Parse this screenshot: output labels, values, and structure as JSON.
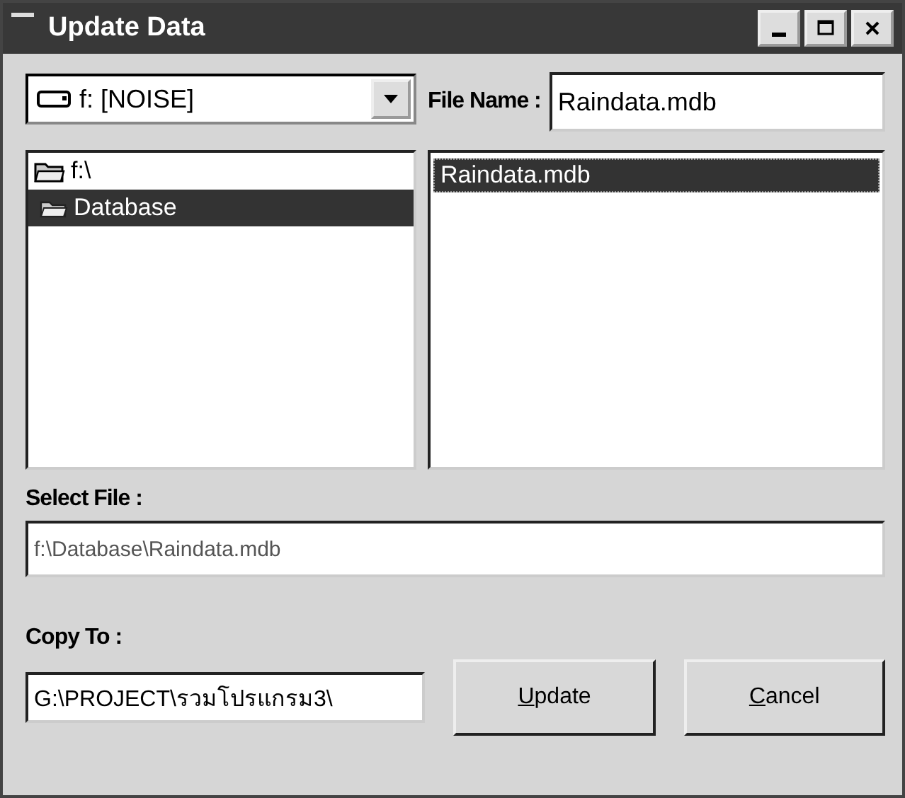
{
  "window": {
    "title": "Update Data"
  },
  "drive": {
    "value": "f: [NOISE]"
  },
  "file_name": {
    "label": "File Name :",
    "value": "Raindata.mdb"
  },
  "folders": [
    {
      "label": "f:\\",
      "selected": false,
      "children": [
        {
          "label": "Database",
          "selected": true
        }
      ]
    }
  ],
  "files": [
    {
      "label": "Raindata.mdb",
      "selected": true
    }
  ],
  "select_file": {
    "label": "Select File :",
    "value": "f:\\Database\\Raindata.mdb"
  },
  "copy_to": {
    "label": "Copy To :",
    "value": "G:\\PROJECT\\รวมโปรแกรม3\\"
  },
  "buttons": [
    "Update",
    "Cancel"
  ]
}
